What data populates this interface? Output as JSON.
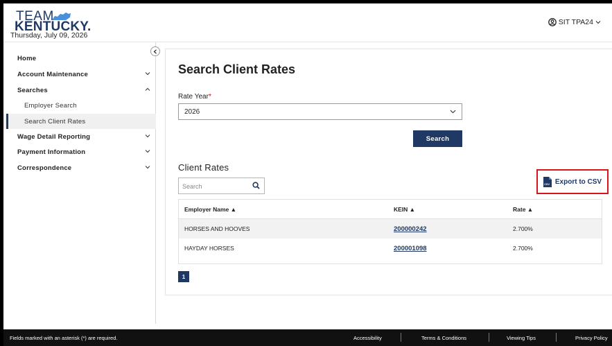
{
  "header": {
    "logo_team": "TEAM",
    "logo_kentucky": "KENTUCKY.",
    "date": "Thursday, July 09, 2026",
    "user": "SIT TPA24"
  },
  "sidebar": {
    "items": [
      {
        "label": "Home"
      },
      {
        "label": "Account Maintenance"
      },
      {
        "label": "Searches"
      },
      {
        "label": "Employer Search"
      },
      {
        "label": "Search Client Rates"
      },
      {
        "label": "Wage Detail Reporting"
      },
      {
        "label": "Payment Information"
      },
      {
        "label": "Correspondence"
      }
    ]
  },
  "main": {
    "title": "Search Client Rates",
    "rate_year_label": "Rate Year",
    "required_mark": "*",
    "rate_year_value": "2026",
    "search_button": "Search",
    "section_title": "Client Rates",
    "table_search_placeholder": "Search",
    "export_label": "Export to CSV",
    "export_badge": "CSV",
    "columns": [
      "Employer Name ▲",
      "KEIN ▲",
      "Rate ▲"
    ],
    "rows": [
      {
        "employer": "HORSES AND HOOVES",
        "kein": "200000242",
        "rate": "2.700%"
      },
      {
        "employer": "HAYDAY HORSES",
        "kein": "200001098",
        "rate": "2.700%"
      }
    ],
    "current_page": "1"
  },
  "footer": {
    "note": "Fields marked with an asterisk (*) are required.",
    "links": [
      "Accessibility",
      "Terms & Conditions",
      "Viewing Tips",
      "Privacy Policy"
    ]
  },
  "colors": {
    "brand": "#1f3864",
    "highlight": "#d9141b"
  }
}
